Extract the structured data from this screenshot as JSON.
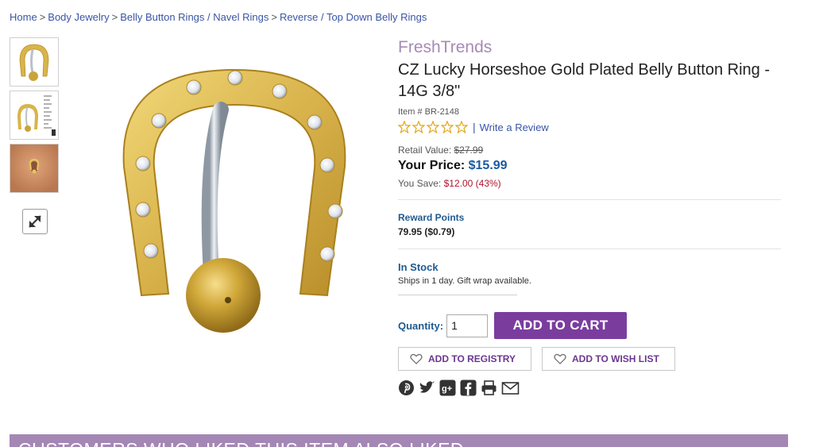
{
  "breadcrumb": {
    "items": [
      "Home",
      "Body Jewelry",
      "Belly Button Rings / Navel Rings",
      "Reverse / Top Down Belly Rings"
    ],
    "separator": ">"
  },
  "thumbnails": [
    "thumbnail-horseshoe",
    "thumbnail-dimensions",
    "thumbnail-worn"
  ],
  "product": {
    "brand": "FreshTrends",
    "title": "CZ Lucky Horseshoe Gold Plated Belly Button Ring - 14G 3/8\"",
    "item_number": "Item # BR-2148",
    "rating_separator": "|",
    "write_review": "Write a Review",
    "retail_label": "Retail Value:",
    "retail_value": "$27.99",
    "price_label": "Your Price:",
    "price_value": "$15.99",
    "save_label": "You Save:",
    "save_value": "$12.00 (43%)",
    "reward_label": "Reward Points",
    "reward_value": "79.95 ($0.79)",
    "stock_label": "In Stock",
    "ships_text": "Ships in 1 day. Gift wrap available."
  },
  "purchase": {
    "quantity_label": "Quantity:",
    "quantity_value": "1",
    "add_to_cart": "ADD TO CART",
    "add_to_registry": "ADD TO REGISTRY",
    "add_to_wishlist": "ADD TO WISH LIST"
  },
  "social_icons": [
    "pinterest-icon",
    "twitter-icon",
    "google-plus-icon",
    "facebook-icon",
    "print-icon",
    "email-icon"
  ],
  "section_banner": "CUSTOMERS WHO LIKED THIS ITEM ALSO LIKED",
  "colors": {
    "accent_purple": "#7a3d9e",
    "brand_lavender": "#a58bb5",
    "link_blue": "#3a55a4",
    "price_blue": "#1a5aa0",
    "save_red": "#b0142c",
    "gold": "#d9b44a"
  }
}
